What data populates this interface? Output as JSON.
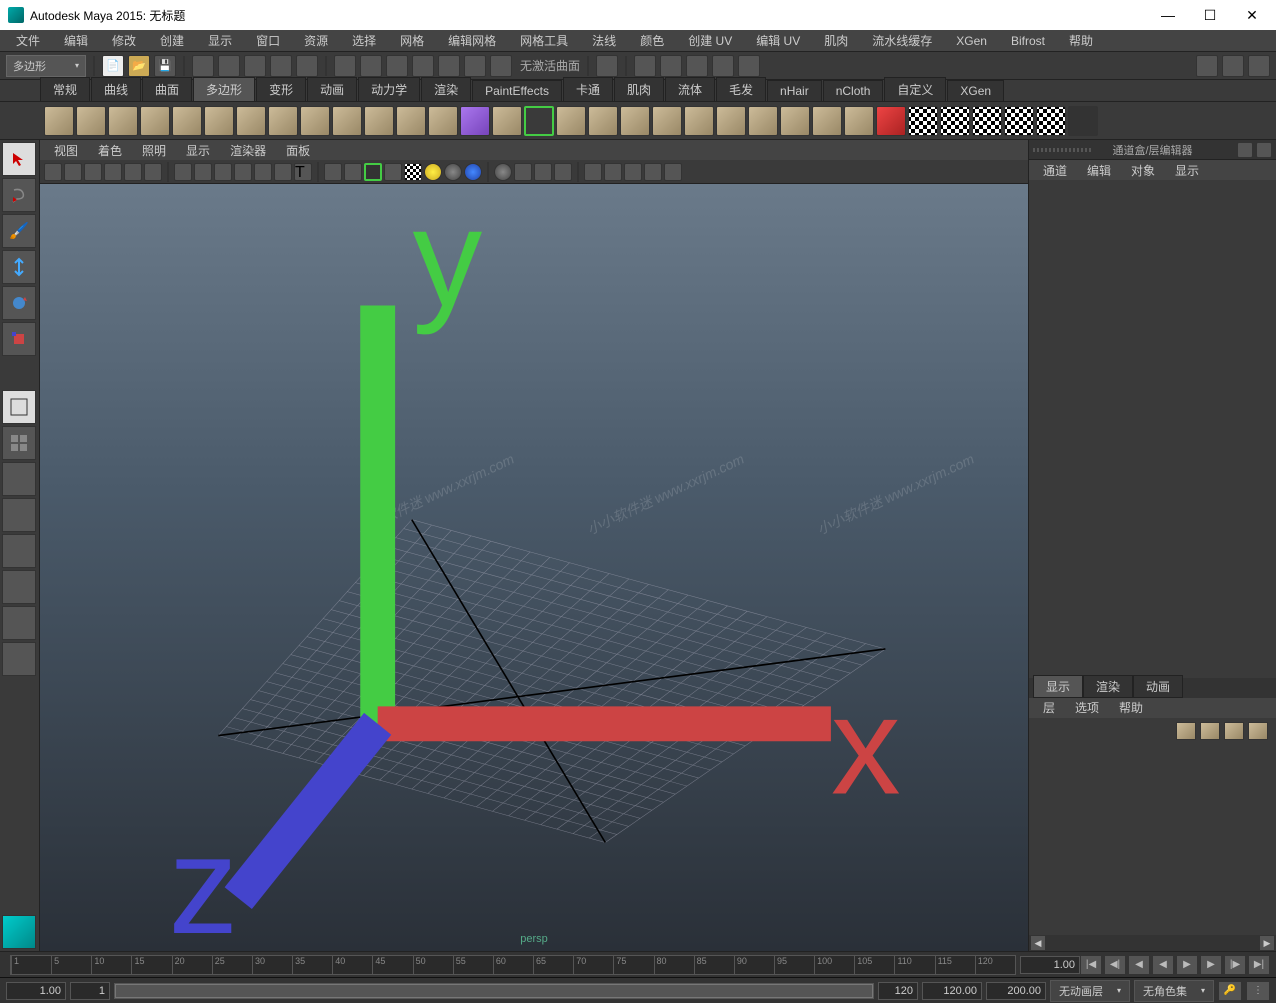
{
  "titlebar": {
    "text": "Autodesk Maya 2015: 无标题",
    "min": "—",
    "max": "☐",
    "close": "✕"
  },
  "menubar": [
    "文件",
    "编辑",
    "修改",
    "创建",
    "显示",
    "窗口",
    "资源",
    "选择",
    "网格",
    "编辑网格",
    "网格工具",
    "法线",
    "颜色",
    "创建 UV",
    "编辑 UV",
    "肌肉",
    "流水线缓存",
    "XGen",
    "Bifrost",
    "帮助"
  ],
  "statusline": {
    "mode": "多边形",
    "label": "无激活曲面"
  },
  "shelf_tabs": [
    "常规",
    "曲线",
    "曲面",
    "多边形",
    "变形",
    "动画",
    "动力学",
    "渲染",
    "PaintEffects",
    "卡通",
    "肌肉",
    "流体",
    "毛发",
    "nHair",
    "nCloth",
    "自定义",
    "XGen"
  ],
  "shelf_active": 3,
  "panel_menu": [
    "视图",
    "着色",
    "照明",
    "显示",
    "渲染器",
    "面板"
  ],
  "right_panel": {
    "header": "通道盒/层编辑器",
    "menu": [
      "通道",
      "编辑",
      "对象",
      "显示"
    ],
    "tabs": [
      "显示",
      "渲染",
      "动画"
    ],
    "active_tab": 0,
    "layer_menu": [
      "层",
      "选项",
      "帮助"
    ]
  },
  "persp": "persp",
  "timeline": {
    "ticks": [
      "1",
      "5",
      "10",
      "15",
      "20",
      "25",
      "30",
      "35",
      "40",
      "45",
      "50",
      "55",
      "60",
      "65",
      "70",
      "75",
      "80",
      "85",
      "90",
      "95",
      "100",
      "105",
      "110",
      "115",
      "120"
    ],
    "current": "1.00"
  },
  "range": {
    "start_outer": "1.00",
    "start_inner": "1",
    "end_inner": "120",
    "end_outer": "120.00",
    "fps": "200.00",
    "anim_layer": "无动画层",
    "char_set": "无角色集"
  },
  "watermarks": [
    "小小软件迷 www.xxrjm.com",
    "小小软件迷 www.xxrjm.com",
    "小小软件迷 www.xxrjm.com"
  ]
}
